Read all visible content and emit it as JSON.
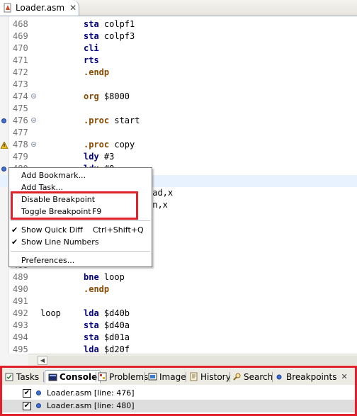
{
  "editor_tab": {
    "title": "Loader.asm",
    "close": "✕"
  },
  "lines": [
    {
      "num": "468",
      "label": "",
      "op": "sta",
      "arg": "colpf1",
      "kind": "kw"
    },
    {
      "num": "469",
      "label": "",
      "op": "sta",
      "arg": "colpf3",
      "kind": "kw"
    },
    {
      "num": "470",
      "label": "",
      "op": "cli",
      "arg": "",
      "kind": "kw"
    },
    {
      "num": "471",
      "label": "",
      "op": "rts",
      "arg": "",
      "kind": "kw"
    },
    {
      "num": "472",
      "label": "",
      "op": ".endp",
      "arg": "",
      "kind": "dir"
    },
    {
      "num": "473",
      "label": "",
      "op": "",
      "arg": "",
      "kind": "kw"
    },
    {
      "num": "474",
      "label": "",
      "op": "org",
      "arg": "$8000",
      "kind": "dir",
      "fold": true
    },
    {
      "num": "475",
      "label": "",
      "op": "",
      "arg": "",
      "kind": "kw"
    },
    {
      "num": "476",
      "label": "",
      "op": ".proc",
      "arg": "start",
      "kind": "dir",
      "fold": true,
      "marker": "breakpoint"
    },
    {
      "num": "477",
      "label": "",
      "op": "",
      "arg": "",
      "kind": "kw"
    },
    {
      "num": "478",
      "label": "",
      "op": ".proc",
      "arg": "copy",
      "kind": "dir",
      "fold": true,
      "marker": "warning"
    },
    {
      "num": "479",
      "label": "",
      "op": "ldy",
      "arg": "#3",
      "kind": "kw"
    },
    {
      "num": "480",
      "label": "",
      "op": "ldx",
      "arg": "#0",
      "kind": "kw",
      "marker": "breakpoint"
    },
    {
      "num": "481",
      "label": "",
      "op": "",
      "arg": "",
      "kind": "kw",
      "highlight": true
    },
    {
      "num": "482",
      "label": "",
      "op": "",
      "arg": "oad,x",
      "kind": "kw"
    },
    {
      "num": "483",
      "label": "",
      "op": "",
      "arg": "un,x",
      "kind": "kw"
    },
    {
      "num": "484",
      "label": "",
      "op": "",
      "arg": "",
      "kind": "kw"
    },
    {
      "num": "485",
      "label": "",
      "op": "",
      "arg": "",
      "kind": "kw"
    },
    {
      "num": "486",
      "label": "",
      "op": "",
      "arg": "",
      "kind": "kw"
    },
    {
      "num": "487",
      "label": "",
      "op": "",
      "arg": "",
      "kind": "kw"
    },
    {
      "num": "488",
      "label": "",
      "op": "",
      "arg": "",
      "kind": "kw"
    },
    {
      "num": "489",
      "label": "",
      "op": "bne",
      "arg": "loop",
      "kind": "kw"
    },
    {
      "num": "490",
      "label": "",
      "op": ".endp",
      "arg": "",
      "kind": "dir"
    },
    {
      "num": "491",
      "label": "",
      "op": "",
      "arg": "",
      "kind": "kw"
    },
    {
      "num": "492",
      "label": "loop",
      "op": "lda",
      "arg": "$d40b",
      "kind": "kw"
    },
    {
      "num": "493",
      "label": "",
      "op": "sta",
      "arg": "$d40a",
      "kind": "kw"
    },
    {
      "num": "494",
      "label": "",
      "op": "sta",
      "arg": "$d01a",
      "kind": "kw"
    },
    {
      "num": "495",
      "label": "",
      "op": "lda",
      "arg": "$d20f",
      "kind": "kw"
    }
  ],
  "context_menu": {
    "add_bookmark": "Add Bookmark...",
    "add_task": "Add Task...",
    "disable_breakpoint": "Disable Breakpoint",
    "toggle_breakpoint": "Toggle Breakpoint",
    "toggle_breakpoint_shortcut": "F9",
    "show_quick_diff": "Show Quick Diff",
    "show_quick_diff_shortcut": "Ctrl+Shift+Q",
    "show_line_numbers": "Show Line Numbers",
    "preferences": "Preferences...",
    "check": "✔"
  },
  "bottom_tabs": {
    "tasks": "Tasks",
    "console": "Console",
    "problems": "Problems",
    "image": "Image",
    "history": "History",
    "search": "Search",
    "breakpoints": "Breakpoints",
    "close": "✕"
  },
  "breakpoints": [
    {
      "text": "Loader.asm [line: 476]",
      "checked": "✔"
    },
    {
      "text": "Loader.asm [line: 480]",
      "checked": "✔"
    }
  ],
  "colors": {
    "highlight_red": "#e0202a",
    "keyword_blue": "#000080",
    "directive_brown": "#8a4a00",
    "breakpoint_blue": "#3f6fd0"
  }
}
